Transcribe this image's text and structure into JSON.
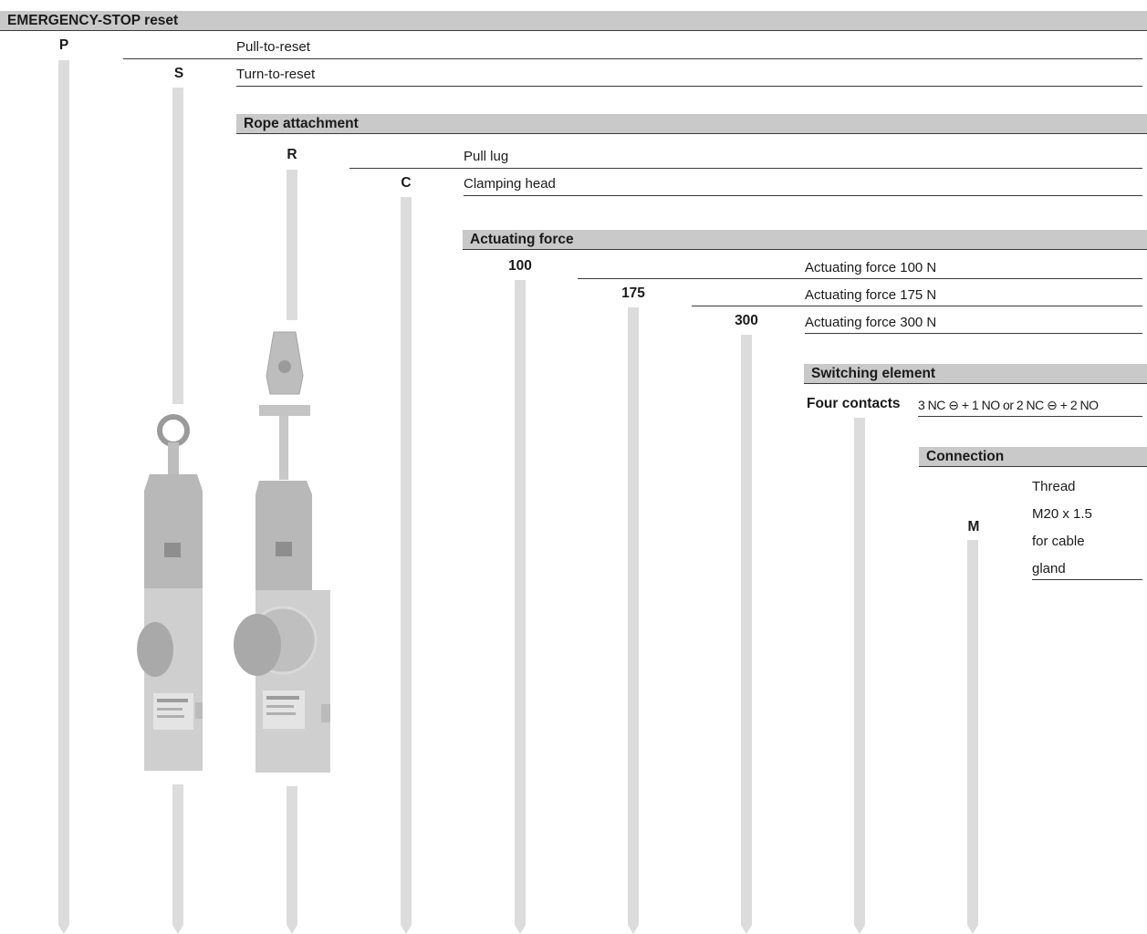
{
  "reset": {
    "header": "EMERGENCY-STOP reset",
    "options": [
      {
        "code": "P",
        "label": "Pull-to-reset"
      },
      {
        "code": "S",
        "label": "Turn-to-reset"
      }
    ]
  },
  "rope": {
    "header": "Rope attachment",
    "options": [
      {
        "code": "R",
        "label": "Pull lug"
      },
      {
        "code": "C",
        "label": "Clamping head"
      }
    ]
  },
  "force": {
    "header": "Actuating force",
    "options": [
      {
        "code": "100",
        "label": "Actuating force 100 N"
      },
      {
        "code": "175",
        "label": "Actuating force 175 N"
      },
      {
        "code": "300",
        "label": "Actuating force 300 N"
      }
    ]
  },
  "switching": {
    "header": "Switching element",
    "code": "Four contacts",
    "label": "3 NC ⊖ + 1 NO or 2 NC ⊖ + 2 NO"
  },
  "connection": {
    "header": "Connection",
    "code": "M",
    "label_lines": [
      "Thread",
      "M20 x 1.5",
      "for cable",
      "gland"
    ]
  },
  "colors": {
    "header_bg": "#c9c9c9",
    "stem": "#dcdcdc",
    "rule": "#3a3a3a"
  }
}
